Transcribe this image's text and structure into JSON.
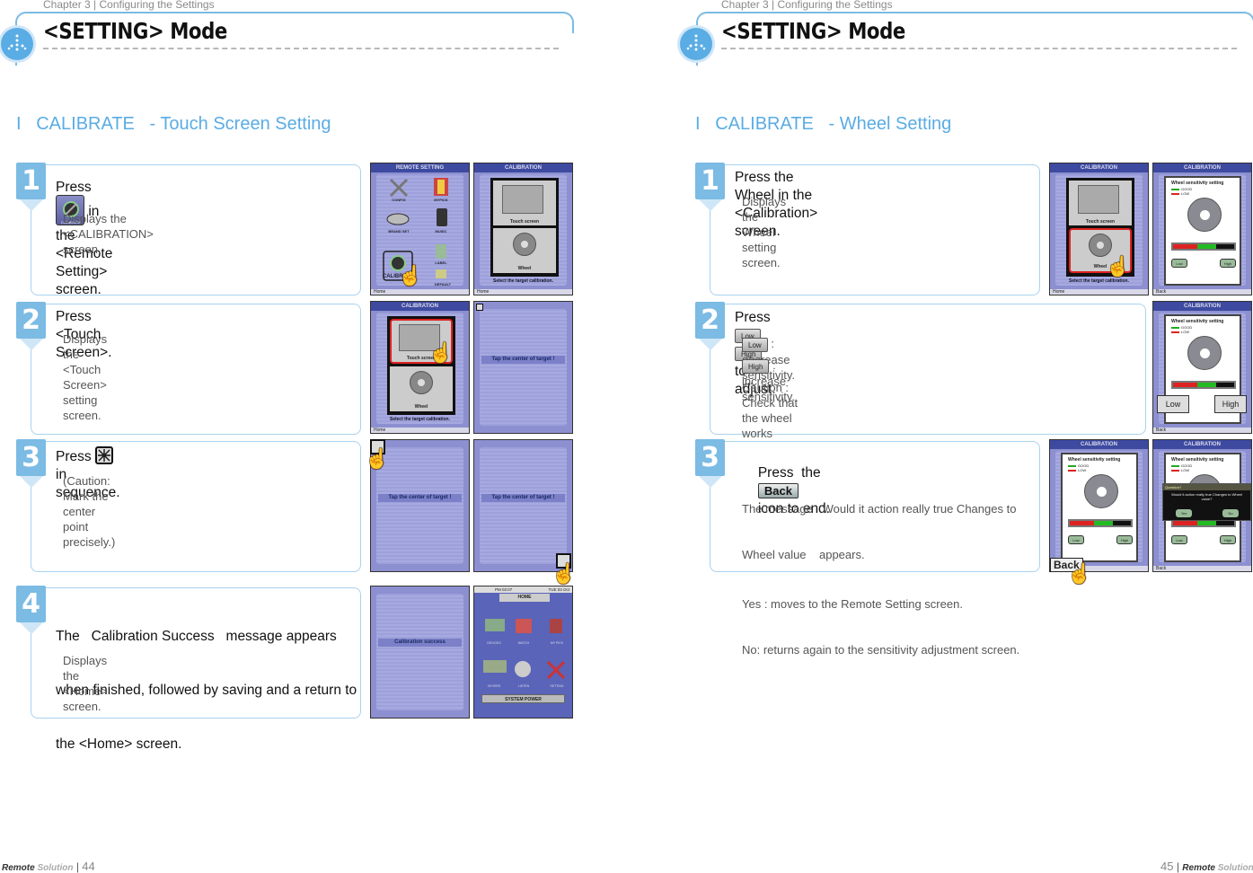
{
  "left_page": {
    "chapter": "Chapter 3 | Configuring the Settings",
    "mode_title": "<SETTING> Mode",
    "section_title": "I   CALIBRATE   - Touch Screen Setting",
    "steps": [
      {
        "number": "1",
        "main_prefix": "Press",
        "main_suffix": "in the <Remote Setting> screen.",
        "icon": "calibrate-icon",
        "icon_label": "CALIBRATE",
        "sub": "Displays the <CALIBRATION> screen."
      },
      {
        "number": "2",
        "main": "Press <Touch Screen>.",
        "sub": "Displays the <Touch Screen> setting screen."
      },
      {
        "number": "3",
        "main_prefix": "Press",
        "main_suffix": "in sequence.",
        "icon": "target-icon",
        "sub": "(Caution: Mark the center point precisely.)"
      },
      {
        "number": "4",
        "main_lines": [
          "The   Calibration Success   message appears",
          "when finished, followed by saving and a return to",
          "the <Home> screen."
        ],
        "sub": "Displays the <Home> screen."
      }
    ],
    "screens": {
      "remote_setting": {
        "title": "REMOTE SETTING",
        "items": [
          "CONFIG",
          "MYPICK",
          "BRAND SET",
          "MUSIC",
          "CALIBRATE",
          "LABEL",
          "DEFAULT"
        ],
        "footer": "Home"
      },
      "calibration": {
        "title": "CALIBRATION",
        "touch_label": "Touch screen",
        "wheel_label": "Wheel",
        "prompt": "Select the target calibration.",
        "footer": "Home"
      },
      "tap_target": {
        "message": "Tap the center of target !"
      },
      "success": {
        "message": "Calibration success"
      },
      "home": {
        "status_time": "PM 02:07",
        "status_date": "TUE 03 Oct",
        "title": "HOME",
        "items": [
          "DEVICES",
          "WATCH",
          "MY PICK",
          "OHTERS",
          "LISTEN",
          "SETTING"
        ],
        "power": "SYSTEM POWER"
      }
    },
    "footer": {
      "brand": "Remote",
      "brand_suffix": "Solution",
      "page_number": "44"
    }
  },
  "right_page": {
    "chapter": "Chapter 3 | Configuring the Settings",
    "mode_title": "<SETTING> Mode",
    "section_title": "I   CALIBRATE   - Wheel Setting",
    "steps": [
      {
        "number": "1",
        "main": "Press the Wheel in the <Calibration> screen.",
        "sub": "Displays the Wheel setting screen."
      },
      {
        "number": "2",
        "main_prefix": "Press",
        "main_suffix": "to adjust.",
        "low_label": "Low",
        "high_label": "High",
        "low_desc": ": decrease sensitivity.",
        "high_desc": ": increase sensitivity.",
        "caution": "Caution : Check that the wheel works properly after adjustment is complete."
      },
      {
        "number": "3",
        "main_prefix": "Press  the",
        "main_suffix": "icon to end.",
        "back_label": "Back",
        "sub_lines": [
          "The message   Would it action really true Changes to",
          "Wheel value    appears.",
          "Yes : moves to the Remote Setting screen.",
          "No: returns again to the sensitivity adjustment screen."
        ]
      }
    ],
    "screens": {
      "calibration": {
        "title": "CALIBRATION",
        "touch_label": "Touch screen",
        "wheel_label": "Wheel",
        "prompt": "Select the target calibration.",
        "footer": "Home"
      },
      "wheel": {
        "title": "CALIBRATION",
        "heading": "Wheel sensitivity setting",
        "legend_good": "GOOD",
        "legend_low": "LOW",
        "low_btn": "Low",
        "high_btn": "High",
        "footer": "Back",
        "back_btn": "Back"
      },
      "dialog": {
        "title": "Question?",
        "text": "Would it action really true Changes to Wheel value?",
        "yes": "Yes",
        "no": "No"
      }
    },
    "footer": {
      "page_number": "45",
      "brand": "Remote",
      "brand_suffix": "Solution"
    }
  }
}
